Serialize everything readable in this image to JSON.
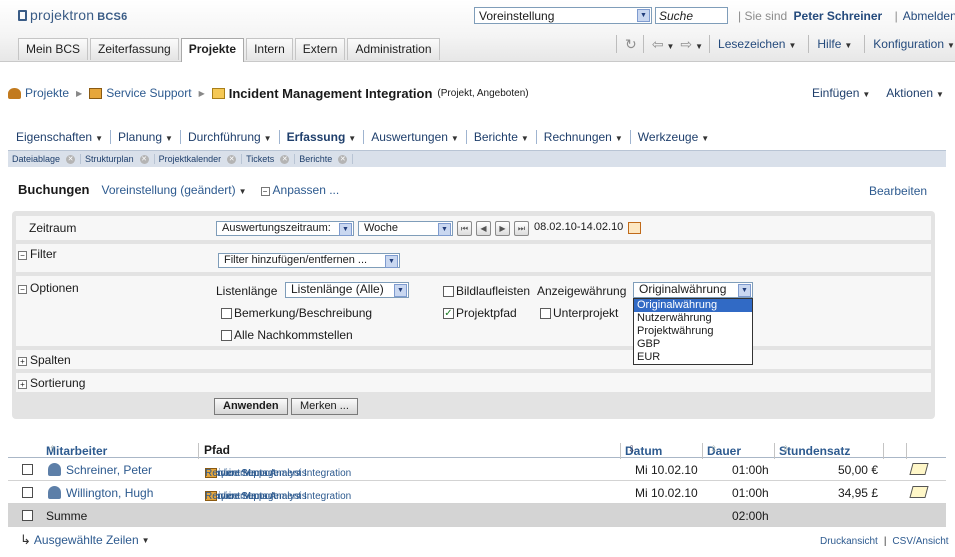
{
  "app": {
    "logo_text": "projektron",
    "logo_version": "BCS6"
  },
  "header": {
    "preset_select": "Voreinstellung",
    "search_value": "Suche",
    "you_are_label": "Sie sind",
    "user_name": "Peter Schreiner",
    "logout_label": "Abmelden"
  },
  "main_tabs": [
    {
      "label": "Mein BCS"
    },
    {
      "label": "Zeiterfassung"
    },
    {
      "label": "Projekte",
      "active": true
    },
    {
      "label": "Intern"
    },
    {
      "label": "Extern"
    },
    {
      "label": "Administration"
    }
  ],
  "toolbar": {
    "bookmarks": "Lesezeichen",
    "help": "Hilfe",
    "config": "Konfiguration"
  },
  "breadcrumb": {
    "root": "Projekte",
    "parent": "Service Support",
    "current": "Incident Management Integration",
    "current_sub": "(Projekt, Angeboten)"
  },
  "page_actions": {
    "insert": "Einfügen",
    "actions": "Aktionen"
  },
  "project_menu": [
    {
      "label": "Eigenschaften"
    },
    {
      "label": "Planung"
    },
    {
      "label": "Durchführung"
    },
    {
      "label": "Erfassung",
      "active": true
    },
    {
      "label": "Auswertungen"
    },
    {
      "label": "Berichte"
    },
    {
      "label": "Rechnungen"
    },
    {
      "label": "Werkzeuge"
    }
  ],
  "subtabs": [
    "Dateiablage",
    "Strukturplan",
    "Projektkalender",
    "Tickets",
    "Berichte"
  ],
  "view": {
    "title": "Buchungen",
    "preset": "Voreinstellung (geändert)",
    "adjust": "Anpassen ...",
    "edit": "Bearbeiten"
  },
  "filter_panel": {
    "period_label": "Zeitraum",
    "period_mode": "Auswertungszeitraum:",
    "period_unit": "Woche",
    "period_range": "08.02.10-14.02.10",
    "filter_label": "Filter",
    "filter_select": "Filter hinzufügen/entfernen ...",
    "options_label": "Optionen",
    "list_length_label": "Listenlänge",
    "list_length_value": "Listenlänge (Alle)",
    "scrollbars_label": "Bildlaufleisten",
    "currency_label": "Anzeigewährung",
    "currency_value": "Originalwährung",
    "currency_options": [
      "Originalwährung",
      "Nutzerwährung",
      "Projektwährung",
      "GBP",
      "EUR"
    ],
    "remark_label": "Bemerkung/Beschreibung",
    "project_path_label": "Projektpfad",
    "subproject_label": "Unterprojekt",
    "all_decimals_label": "Alle Nachkommstellen",
    "columns_label": "Spalten",
    "sorting_label": "Sortierung",
    "apply_label": "Anwenden",
    "remember_label": "Merken ..."
  },
  "table": {
    "headers": {
      "employee": "Mitarbeiter",
      "path": "Pfad",
      "date": "Datum",
      "duration": "Dauer",
      "rate": "Stundensatz"
    },
    "rows": [
      {
        "employee": "Schreiner, Peter",
        "path": [
          "Service Support",
          "Incident Management Integration",
          "Requirements Analysis"
        ],
        "date": "Mi 10.02.10",
        "duration": "01:00h",
        "rate": "50,00 €"
      },
      {
        "employee": "Willington, Hugh",
        "path": [
          "Service Support",
          "Incident Management Integration",
          "Requirements Analysis"
        ],
        "date": "Mi 10.02.10",
        "duration": "01:00h",
        "rate": "34,95 £"
      }
    ],
    "sum_label": "Summe",
    "sum_duration": "02:00h"
  },
  "footer": {
    "selected_rows": "Ausgewählte Zeilen",
    "print_view": "Druckansicht",
    "csv_view": "CSV/Ansicht"
  }
}
